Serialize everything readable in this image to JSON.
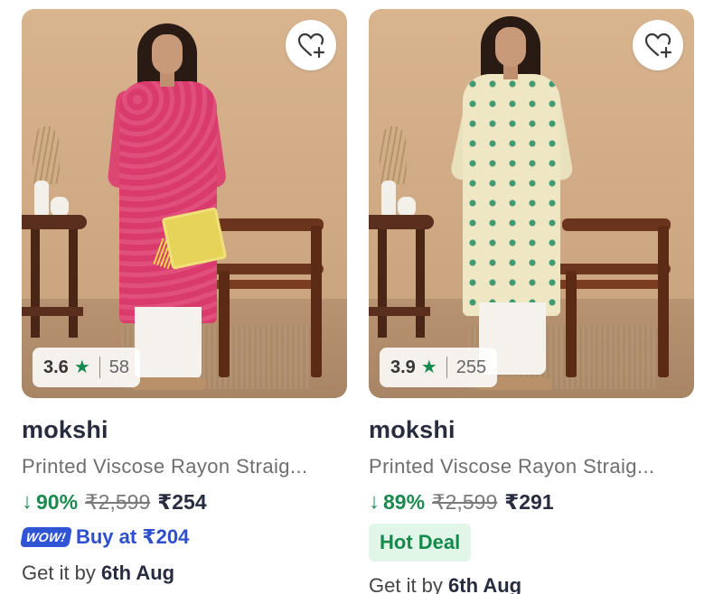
{
  "products": [
    {
      "rating": "3.6",
      "rating_count": "58",
      "brand": "mokshi",
      "name": "Printed Viscose Rayon Straig...",
      "discount": "90%",
      "mrp": "₹2,599",
      "price": "₹254",
      "offer_badge": "WOW!",
      "offer_text": "Buy at ₹204",
      "delivery_prefix": "Get it by",
      "delivery_date": "6th Aug",
      "kurta_color": "#dc4673"
    },
    {
      "rating": "3.9",
      "rating_count": "255",
      "brand": "mokshi",
      "name": "Printed Viscose Rayon Straig...",
      "discount": "89%",
      "mrp": "₹2,599",
      "price": "₹291",
      "deal_label": "Hot Deal",
      "delivery_prefix": "Get it by",
      "delivery_date": "6th Aug",
      "kurta_color": "#efe6c4"
    }
  ],
  "icons": {
    "wishlist": "heart-plus-icon",
    "rating_star": "star-icon",
    "discount_arrow": "arrow-down-icon"
  },
  "colors": {
    "discount_green": "#1b8a4f",
    "offer_blue": "#2c4fcf",
    "deal_bg": "#e2f5e9"
  }
}
